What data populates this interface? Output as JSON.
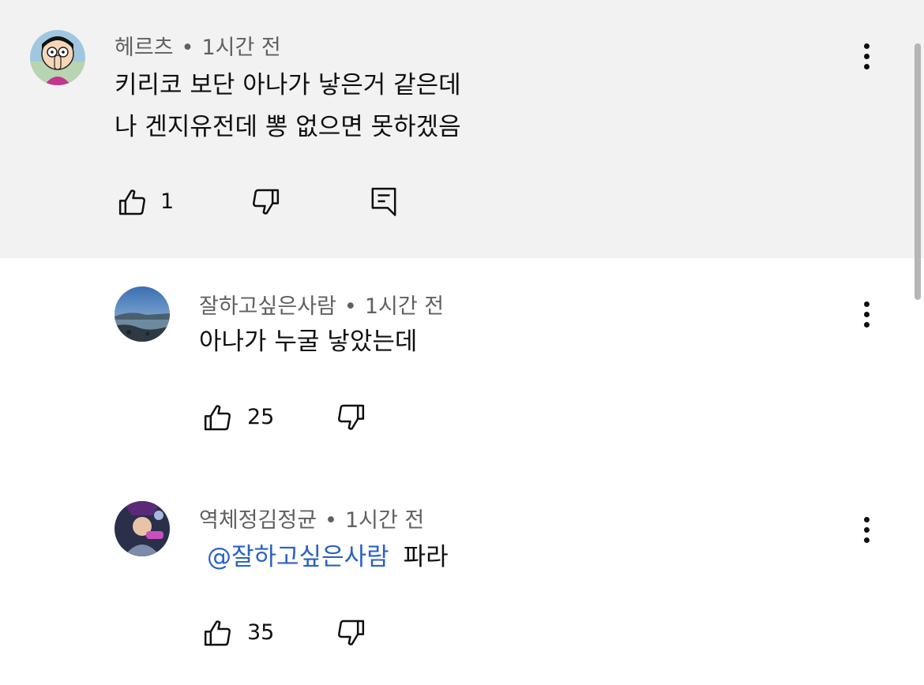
{
  "comments": [
    {
      "author": "헤르츠",
      "time": "1시간 전",
      "text_lines": [
        "키리코 보단 아나가 낳은거 같은데",
        "나 겐지유전데 뽕 없으면 못하겠음"
      ],
      "likes": "1",
      "avatar_icon": "cartoon-character-avatar"
    },
    {
      "author": "잘하고싶은사람",
      "time": "1시간 전",
      "text_lines": [
        "아나가 누굴 낳았는데"
      ],
      "likes": "25",
      "avatar_icon": "seaside-landscape-avatar"
    },
    {
      "author": "역체정김정균",
      "time": "1시간 전",
      "mention": "@잘하고싶은사람",
      "text": "파라",
      "likes": "35",
      "avatar_icon": "costumed-person-avatar"
    }
  ],
  "separator": "•",
  "colors": {
    "highlight_bg": "#f2f2f2",
    "meta_text": "#606060",
    "mention": "#2962c4"
  }
}
